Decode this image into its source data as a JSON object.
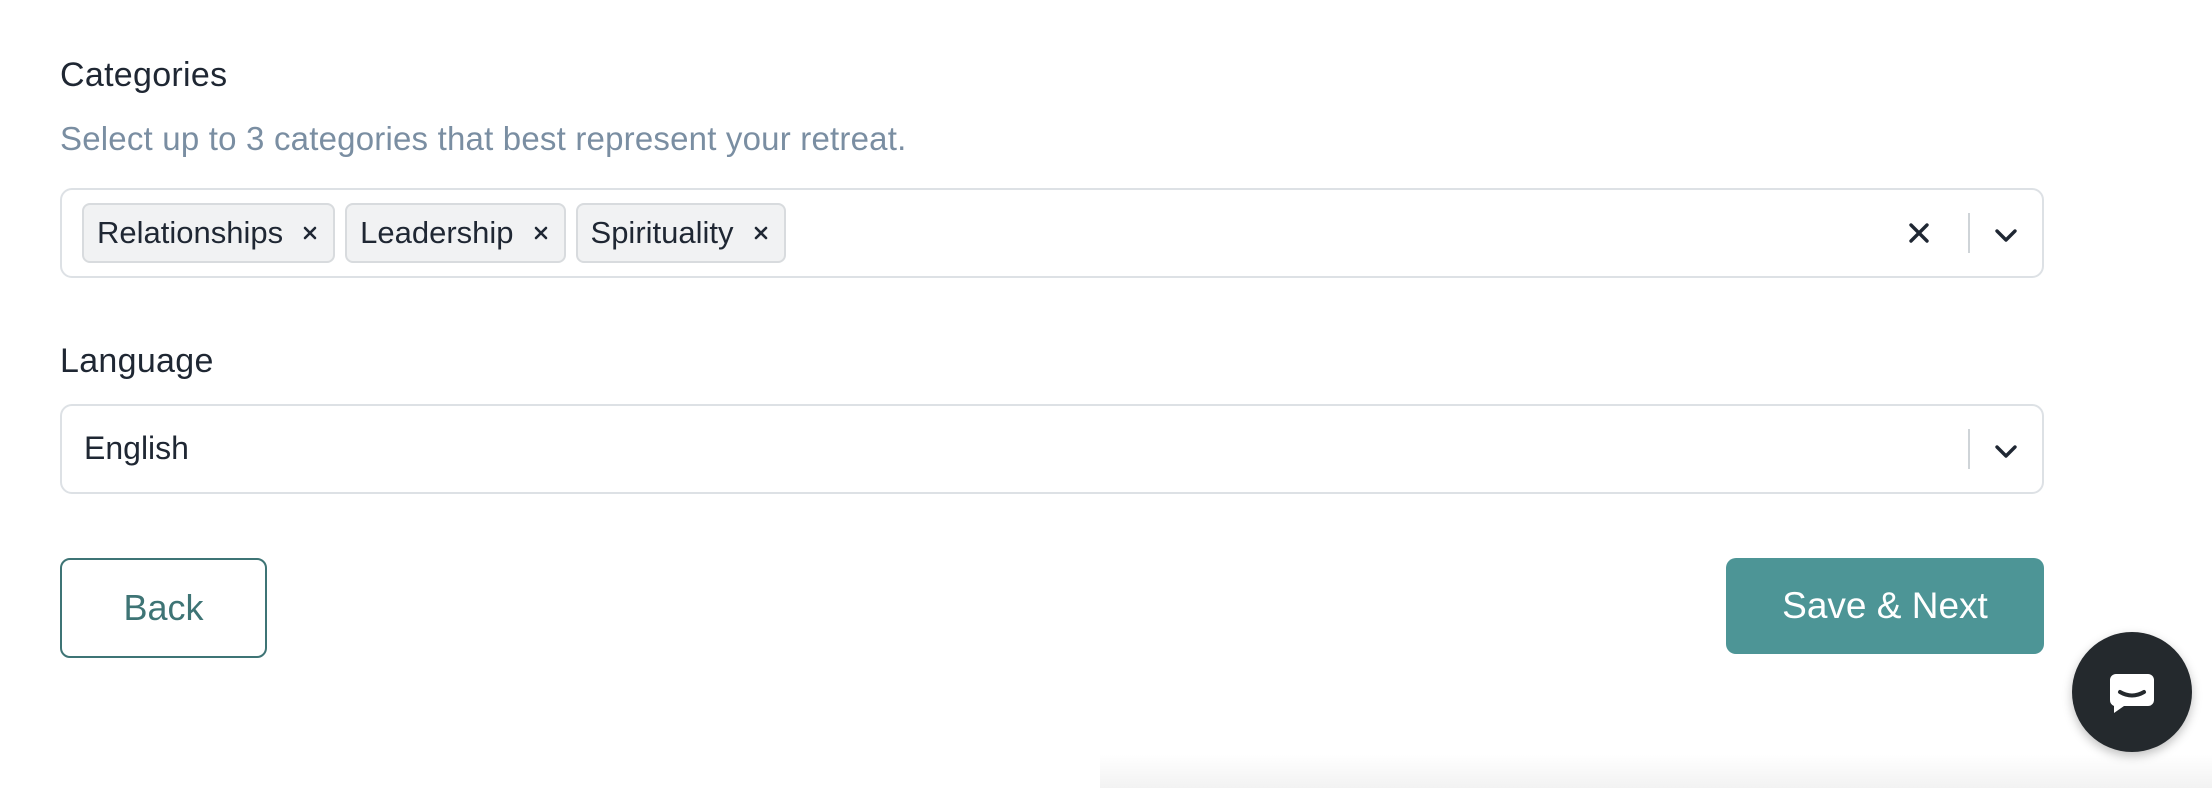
{
  "categories": {
    "label": "Categories",
    "helper": "Select up to 3 categories that best represent your retreat.",
    "selected": [
      {
        "label": "Relationships"
      },
      {
        "label": "Leadership"
      },
      {
        "label": "Spirituality"
      }
    ]
  },
  "language": {
    "label": "Language",
    "value": "English"
  },
  "buttons": {
    "back": "Back",
    "next": "Save & Next"
  },
  "icons": {
    "chip_remove": "close-icon",
    "clear_all": "close-icon",
    "dropdown": "chevron-down-icon",
    "chat": "chat-bubble-icon"
  },
  "colors": {
    "accent": "#4d9596",
    "outline": "#3e7475",
    "helper_text": "#7a8ea2",
    "chat": "#24292d"
  }
}
